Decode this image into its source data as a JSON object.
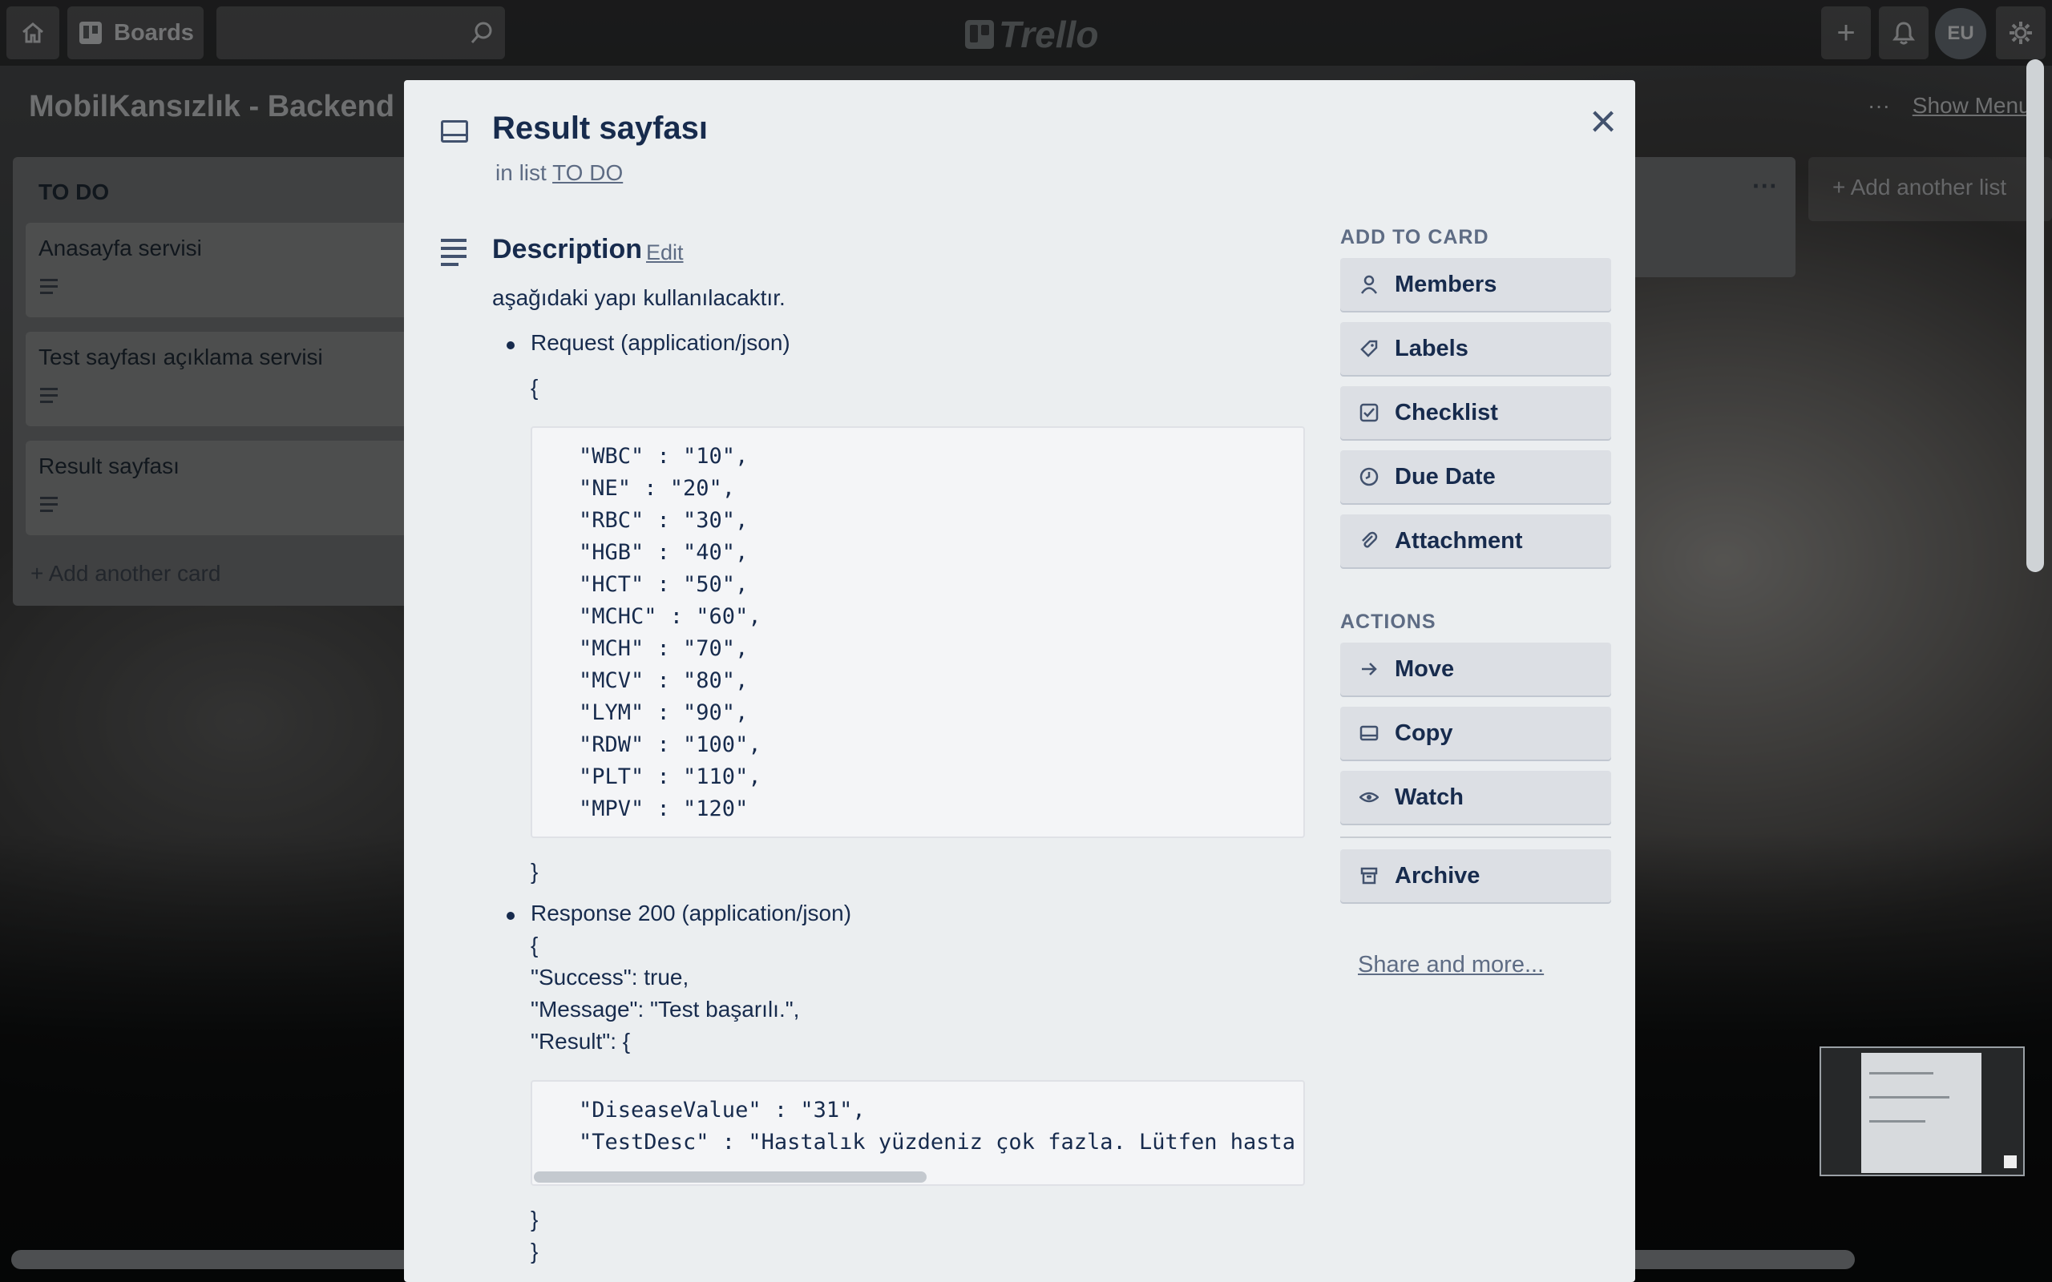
{
  "header": {
    "boards_label": "Boards",
    "logo_text": "Trello",
    "avatar_initials": "EU"
  },
  "board": {
    "title": "MobilKansızlık - Backend",
    "show_menu_label": "Show Menu",
    "add_list_label": "Add another list",
    "lists": [
      {
        "title": "TO DO",
        "cards": [
          "Anasayfa servisi",
          "Test sayfası açıklama servisi",
          "Result sayfası"
        ],
        "add_card_label": "Add another card"
      }
    ]
  },
  "card_modal": {
    "title": "Result sayfası",
    "in_list_prefix": "in list",
    "list_name": "TO DO",
    "description": {
      "heading": "Description",
      "edit_label": "Edit",
      "intro": "aşağıdaki yapı kullanılacaktır.",
      "request_label": "Request (application/json)",
      "request_open": "{",
      "request_code": [
        "\"WBC\" : \"10\",",
        "\"NE\" : \"20\",",
        "\"RBC\" : \"30\",",
        "\"HGB\" : \"40\",",
        "\"HCT\" : \"50\",",
        "\"MCHC\" : \"60\",",
        "\"MCH\" : \"70\",",
        "\"MCV\" : \"80\",",
        "\"LYM\" : \"90\",",
        "\"RDW\" : \"100\",",
        "\"PLT\" : \"110\",",
        "\"MPV\" : \"120\""
      ],
      "request_close": "}",
      "response_label": "Response 200 (application/json)",
      "response_lines": [
        "{",
        "\"Success\": true,",
        "\"Message\": \"Test başarılı.\",",
        "\"Result\": {"
      ],
      "response_code": [
        "\"DiseaseValue\" : \"31\",",
        "\"TestDesc\" : \"Hastalık yüzdeniz çok fazla. Lütfen hasta"
      ],
      "response_close": [
        "}",
        "}"
      ]
    },
    "sidebar": {
      "add_to_card_heading": "ADD TO CARD",
      "add_to_card": [
        {
          "label": "Members",
          "icon": "person-icon"
        },
        {
          "label": "Labels",
          "icon": "tag-icon"
        },
        {
          "label": "Checklist",
          "icon": "checkbox-icon"
        },
        {
          "label": "Due Date",
          "icon": "clock-icon"
        },
        {
          "label": "Attachment",
          "icon": "paperclip-icon"
        }
      ],
      "actions_heading": "ACTIONS",
      "actions": [
        {
          "label": "Move",
          "icon": "arrow-right-icon"
        },
        {
          "label": "Copy",
          "icon": "card-icon"
        },
        {
          "label": "Watch",
          "icon": "eye-icon"
        },
        {
          "label": "Archive",
          "icon": "archive-icon"
        }
      ],
      "share_label": "Share and more..."
    }
  }
}
